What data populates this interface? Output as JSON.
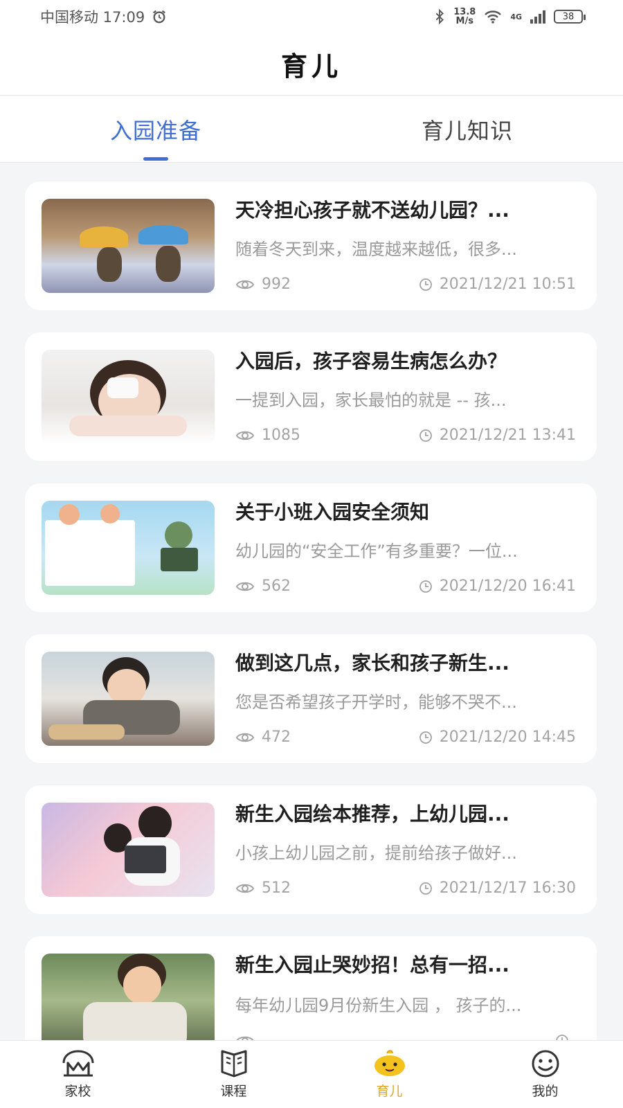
{
  "status_bar": {
    "carrier_time": "中国移动 17:09",
    "net_speed_value": "13.8",
    "net_speed_unit": "M/s",
    "network_type": "4G",
    "battery": "38"
  },
  "header": {
    "title": "育儿"
  },
  "tabs": [
    {
      "label": "入园准备",
      "active": true
    },
    {
      "label": "育儿知识",
      "active": false
    }
  ],
  "articles": [
    {
      "title": "天冷担心孩子就不送幼儿园？...",
      "summary": "随着冬天到来，温度越来越低，很多...",
      "views": "992",
      "date": "2021/12/21 10:51"
    },
    {
      "title": "入园后，孩子容易生病怎么办？",
      "summary": "一提到入园，家长最怕的就是 -- 孩...",
      "views": "1085",
      "date": "2021/12/21 13:41"
    },
    {
      "title": "关于小班入园安全须知",
      "summary": "幼儿园的“安全工作”有多重要？一位...",
      "views": "562",
      "date": "2021/12/20 16:41"
    },
    {
      "title": "做到这几点，家长和孩子新生...",
      "summary": "您是否希望孩子开学时，能够不哭不...",
      "views": "472",
      "date": "2021/12/20 14:45"
    },
    {
      "title": "新生入园绘本推荐，上幼儿园...",
      "summary": "小孩上幼儿园之前，提前给孩子做好...",
      "views": "512",
      "date": "2021/12/17 16:30"
    },
    {
      "title": "新生入园止哭妙招！总有一招...",
      "summary": "每年幼儿园9月份新生入园 ， 孩子的...",
      "views": "",
      "date": ""
    }
  ],
  "bottom_nav": [
    {
      "label": "家校",
      "icon": "school-icon",
      "active": false
    },
    {
      "label": "课程",
      "icon": "book-icon",
      "active": false
    },
    {
      "label": "育儿",
      "icon": "chick-face-icon",
      "active": true
    },
    {
      "label": "我的",
      "icon": "smiley-icon",
      "active": false
    }
  ],
  "colors": {
    "accent": "#3f6fd6",
    "nav_active": "#e0a51f",
    "card_background": "#ffffff",
    "page_background": "#f4f5f7"
  }
}
